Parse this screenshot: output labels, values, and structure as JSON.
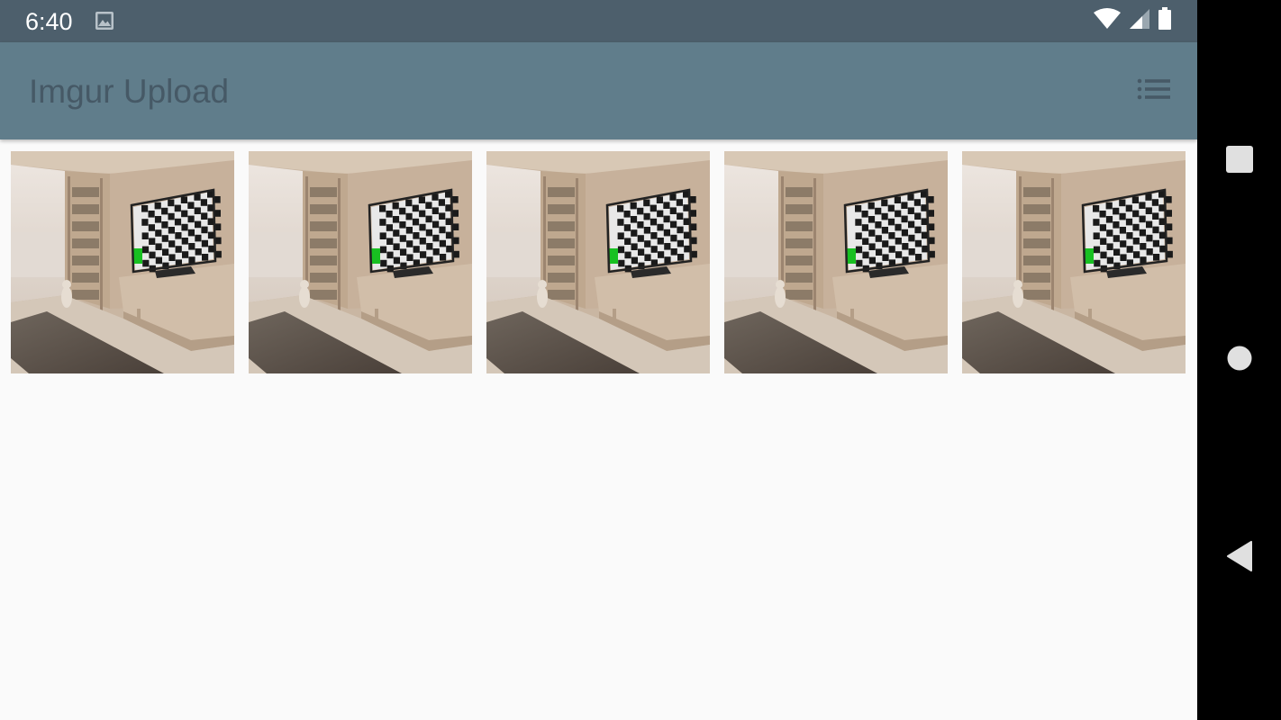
{
  "status_bar": {
    "time": "6:40",
    "notification_icon": "gallery-icon",
    "wifi_icon": "wifi-icon",
    "signal_icon": "cell-signal-icon",
    "battery_icon": "battery-icon"
  },
  "app_bar": {
    "title": "Imgur Upload",
    "action_icon": "list-view-icon"
  },
  "gallery": {
    "items": [
      {
        "icon": "image-thumbnail"
      },
      {
        "icon": "image-thumbnail"
      },
      {
        "icon": "image-thumbnail"
      },
      {
        "icon": "image-thumbnail"
      },
      {
        "icon": "image-thumbnail"
      }
    ]
  },
  "nav_bar": {
    "recents_icon": "square-icon",
    "home_icon": "circle-icon",
    "back_icon": "triangle-back-icon"
  },
  "colors": {
    "status_bar": "#4d5f6c",
    "app_bar": "#607d8b",
    "title_text": "#465966",
    "background": "#fafafa",
    "nav_bar": "#000000",
    "nav_icons": "#e0e0e0"
  }
}
